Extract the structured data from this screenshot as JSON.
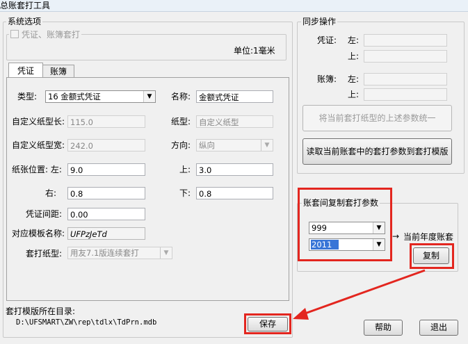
{
  "window": {
    "title": "总账套打工具"
  },
  "system_options": {
    "group_label": "系统选项",
    "checkbox_label": "凭证、账簿套打",
    "unit_label": "单位:1毫米",
    "tabs": [
      "凭证",
      "账簿"
    ],
    "fields": {
      "type_label": "类型:",
      "type_value": "16 金额式凭证",
      "name_label": "名称:",
      "name_value": "金额式凭证",
      "custom_len_label": "自定义纸型长:",
      "custom_len_value": "115.0",
      "paper_label": "纸型:",
      "paper_value": "自定义纸型",
      "custom_wid_label": "自定义纸型宽:",
      "custom_wid_value": "242.0",
      "direction_label": "方向:",
      "direction_value": "纵向",
      "pos_label": "纸张位置: 左:",
      "pos_left_value": "9.0",
      "top_label": "上:",
      "top_value": "3.0",
      "right_label": "右:",
      "right_value": "0.8",
      "bottom_label": "下:",
      "bottom_value": "0.8",
      "spacing_label": "凭证间距:",
      "spacing_value": "0.00",
      "template_label": "对应模板名称:",
      "template_value": "UFPzJeTd",
      "print_paper_label": "套打纸型:",
      "print_paper_value": "用友7.1版连续套打"
    },
    "dir_label": "套打模版所在目录:",
    "dir_path": "D:\\UFSMART\\ZW\\rep\\tdlx\\TdPrn.mdb"
  },
  "sync": {
    "group_label": "同步操作",
    "voucher_label": "凭证:",
    "voucher_left": "左:",
    "voucher_top": "上:",
    "book_label": "账簿:",
    "book_left": "左:",
    "book_top": "上:",
    "unify_button": "将当前套打纸型的上述参数统一",
    "read_button": "读取当前账套中的套打参数到套打模版"
  },
  "copy": {
    "group_label": "账套间复制套打参数",
    "source_value": "999",
    "target_value": "2011",
    "arrow_text": "→",
    "current_year_label": "当前年度账套",
    "copy_button": "复制"
  },
  "buttons": {
    "save": "保存",
    "help": "帮助",
    "exit": "退出"
  },
  "colors": {
    "highlight": "#e3261f",
    "selection": "#3875d7"
  }
}
